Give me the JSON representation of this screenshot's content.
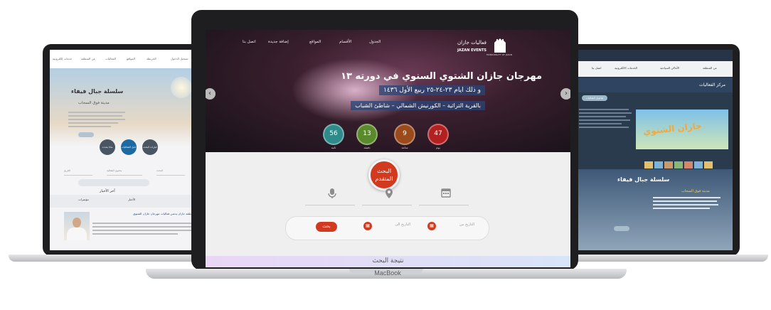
{
  "center": {
    "nav": [
      "الجدول",
      "الأقسام",
      "المواقع",
      "إضافة جديدة",
      "اتصل بنا"
    ],
    "logo_title": "فعاليات جازان",
    "logo_en": "JAZAN EVENTS",
    "logo_sub": "MUNICIPALITY OF JAZAN",
    "logo_caption": "أمانة منطقة جازان",
    "hero_title": "مهرجان جازان الشتوي السنوي في دورته ١٣",
    "hero_dates": "و ذلك ايام ٢٣-٢٤-٢٥ ربيع الأول ١٤٣٦",
    "hero_location": "بالقرية التراثية – الكورنيش الشمالي – شاطئ الشباب",
    "countdown": [
      {
        "value": "56",
        "label": "ثانية",
        "color": "#2f8a8a"
      },
      {
        "value": "13",
        "label": "دقيقة",
        "color": "#5a8a2c"
      },
      {
        "value": "9",
        "label": "ساعة",
        "color": "#9b4a1c"
      },
      {
        "value": "47",
        "label": "يوم",
        "color": "#b32020"
      }
    ],
    "advanced_search": "البحث المتقدم",
    "date_from": "التاريخ من",
    "date_to": "التاريخ الى",
    "search_button": "بحث",
    "result_title": "نتيجة البحث",
    "laptop_label": "MacBook"
  },
  "left": {
    "nav": [
      "تسجيل الدخول",
      "الخريطة",
      "المواقع",
      "الفعاليات",
      "عن المنطقة",
      "خدمات إلكترونية"
    ],
    "title": "سلسلة جبال فيفاء",
    "subtitle": "مدينة فوق السحاب",
    "circles": [
      "ماذا يحدث",
      "دليل الفعاليات",
      "خيارات البحث"
    ],
    "fields": [
      "التاريخ",
      "محتوى الفعالية",
      "البحث"
    ],
    "news_heading": "آخر الأخبار",
    "tab_1": "الأخبار",
    "tab_2": "مؤتمرات",
    "headline": "أمير منطقة جازان يدشن فعاليات مهرجان جازان الشتوي"
  },
  "right": {
    "nav": [
      "عن المنطقة",
      "الأماكن السياحية",
      "الخدمات الالكترونية",
      "اتصل بنا"
    ],
    "section_title": "مركز الفعاليات",
    "program_button": "تفاصيل الفعاليات",
    "banner": "جازان الشتوي",
    "lower_title": "سلسلة جبال فيفاء",
    "lower_sub": "مدينة فوق السحاب"
  },
  "colors": {
    "accent": "#d23a20",
    "frame": "#1e1e21"
  }
}
